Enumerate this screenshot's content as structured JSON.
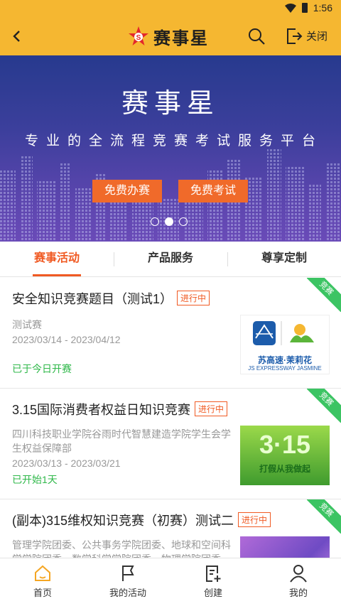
{
  "status_bar": {
    "time": "1:56"
  },
  "header": {
    "title": "赛事星",
    "close_label": "关闭"
  },
  "banner": {
    "title": "赛事星",
    "subtitle": "专业的全流程竞赛考试服务平台",
    "buttons": [
      "免费办赛",
      "免费考试"
    ],
    "slide_count": 3,
    "active_slide": 1
  },
  "tabs": [
    {
      "label": "赛事活动",
      "active": true
    },
    {
      "label": "产品服务",
      "active": false
    },
    {
      "label": "尊享定制",
      "active": false
    }
  ],
  "events": [
    {
      "title": "安全知识竞赛题目（测试1）",
      "badge": "进行中",
      "corner": "竞赛",
      "organizer": "测试赛",
      "dates": "2023/03/14 - 2023/04/12",
      "status": "已于今日开赛",
      "thumb_text": "苏高速·茉莉花",
      "thumb_sub": "JS EXPRESSWAY JASMINE"
    },
    {
      "title": "3.15国际消费者权益日知识竞赛",
      "badge": "进行中",
      "corner": "竞赛",
      "organizer": "四川科技职业学院谷雨时代智慧建造学院学生会学生权益保障部",
      "dates": "2023/03/13 - 2023/03/21",
      "status": "已开始1天",
      "thumb_text": "3·15",
      "thumb_sub": "打假从我做起"
    },
    {
      "title": "(副本)315维权知识竞赛（初赛）测试二",
      "badge": "进行中",
      "corner": "竞赛",
      "organizer": "管理学院团委、公共事务学院团委、地球和空间科学学院团委、数学科学学院团委、物理学院团委",
      "dates": "",
      "status": ""
    }
  ],
  "bottom_nav": [
    {
      "label": "首页",
      "icon": "home-icon",
      "active": true
    },
    {
      "label": "我的活动",
      "icon": "flag-icon",
      "active": false
    },
    {
      "label": "创建",
      "icon": "create-icon",
      "active": false
    },
    {
      "label": "我的",
      "icon": "user-icon",
      "active": false
    }
  ],
  "colors": {
    "header_bg": "#f5b731",
    "accent": "#f05a23",
    "success": "#2fb84a",
    "banner_button": "#f06a2a",
    "corner_ribbon": "#3cc463"
  }
}
